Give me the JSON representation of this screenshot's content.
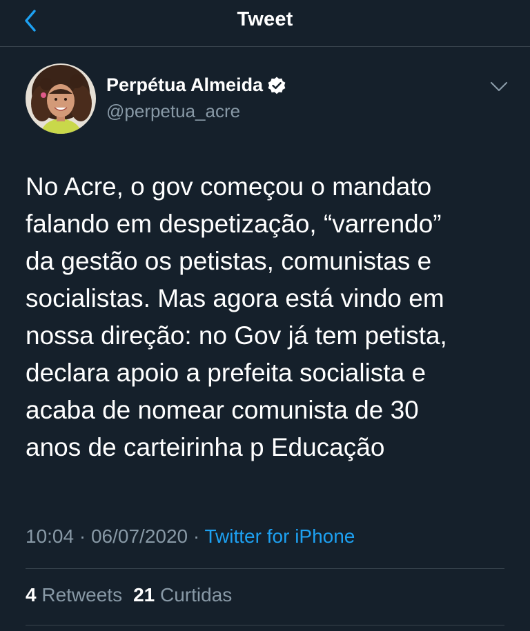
{
  "header": {
    "title": "Tweet",
    "back_icon": "chevron-left-icon"
  },
  "author": {
    "name": "Perpétua Almeida",
    "handle": "@perpetua_acre",
    "verified": true,
    "verified_icon": "verified-badge-icon"
  },
  "menu_icon": "chevron-down-icon",
  "tweet": {
    "lines": [
      "No Acre, o gov começou o mandato",
      "falando em despetização, “varrendo”",
      "da gestão os petistas, comunistas e",
      "socialistas. Mas agora está vindo em",
      "nossa direção: no Gov já tem petista,",
      "declara apoio a prefeita socialista e",
      "acaba de nomear comunista de 30",
      "anos de carteirinha p Educação"
    ]
  },
  "meta": {
    "time": "10:04",
    "separator": " · ",
    "date": "06/07/2020",
    "source": "Twitter for iPhone"
  },
  "stats": {
    "retweets_count": "4",
    "retweets_label": "Retweets",
    "likes_count": "21",
    "likes_label": "Curtidas"
  },
  "colors": {
    "background": "#15202b",
    "accent": "#1da1f2",
    "secondary_text": "#8899a6",
    "divider": "#38444d"
  }
}
